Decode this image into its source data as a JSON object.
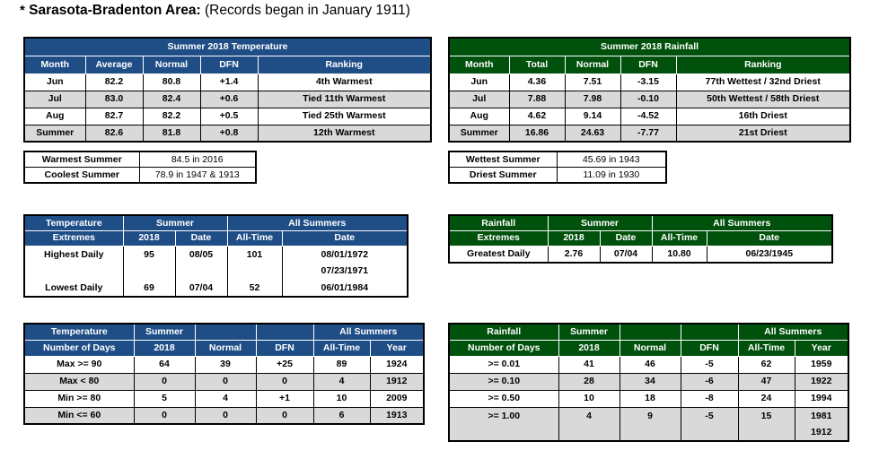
{
  "header": {
    "star": "*",
    "location": "Sarasota-Bradenton Area:",
    "records_note": "(Records began in January 1911)"
  },
  "temperature_summary": {
    "title": "Summer 2018 Temperature",
    "columns": [
      "Month",
      "Average",
      "Normal",
      "DFN",
      "Ranking"
    ],
    "rows": [
      {
        "month": "Jun",
        "average": "82.2",
        "normal": "80.8",
        "dfn": "+1.4",
        "ranking": "4th Warmest"
      },
      {
        "month": "Jul",
        "average": "83.0",
        "normal": "82.4",
        "dfn": "+0.6",
        "ranking": "Tied 11th Warmest"
      },
      {
        "month": "Aug",
        "average": "82.7",
        "normal": "82.2",
        "dfn": "+0.5",
        "ranking": "Tied 25th Warmest"
      },
      {
        "month": "Summer",
        "average": "82.6",
        "normal": "81.8",
        "dfn": "+0.8",
        "ranking": "12th Warmest"
      }
    ]
  },
  "rainfall_summary": {
    "title": "Summer 2018 Rainfall",
    "columns": [
      "Month",
      "Total",
      "Normal",
      "DFN",
      "Ranking"
    ],
    "rows": [
      {
        "month": "Jun",
        "total": "4.36",
        "normal": "7.51",
        "dfn": "-3.15",
        "ranking": "77th Wettest / 32nd Driest"
      },
      {
        "month": "Jul",
        "total": "7.88",
        "normal": "7.98",
        "dfn": "-0.10",
        "ranking": "50th Wettest / 58th Driest"
      },
      {
        "month": "Aug",
        "total": "4.62",
        "normal": "9.14",
        "dfn": "-4.52",
        "ranking": "16th Driest"
      },
      {
        "month": "Summer",
        "total": "16.86",
        "normal": "24.63",
        "dfn": "-7.77",
        "ranking": "21st Driest"
      }
    ]
  },
  "temp_records_box": {
    "rows": [
      {
        "label": "Warmest Summer",
        "value": "84.5 in 2016"
      },
      {
        "label": "Coolest Summer",
        "value": "78.9 in 1947 & 1913"
      }
    ]
  },
  "rain_records_box": {
    "rows": [
      {
        "label": "Wettest Summer",
        "value": "45.69 in 1943"
      },
      {
        "label": "Driest Summer",
        "value": "11.09 in 1930"
      }
    ]
  },
  "temperature_extremes": {
    "corner_line1": "Temperature",
    "corner_line2": "Extremes",
    "group_summer": "Summer",
    "group_all": "All Summers",
    "col_2018": "2018",
    "col_date": "Date",
    "col_alltime": "All-Time",
    "col_alldate": "Date",
    "rows": [
      {
        "label": "Highest Daily",
        "v2018": "95",
        "date": "08/05",
        "alltime": "101",
        "alldate": "08/01/1972"
      },
      {
        "label": "",
        "v2018": "",
        "date": "",
        "alltime": "",
        "alldate": "07/23/1971"
      },
      {
        "label": "Lowest Daily",
        "v2018": "69",
        "date": "07/04",
        "alltime": "52",
        "alldate": "06/01/1984"
      }
    ]
  },
  "rainfall_extremes": {
    "corner_line1": "Rainfall",
    "corner_line2": "Extremes",
    "group_summer": "Summer",
    "group_all": "All Summers",
    "col_2018": "2018",
    "col_date": "Date",
    "col_alltime": "All-Time",
    "col_alldate": "Date",
    "rows": [
      {
        "label": "Greatest Daily",
        "v2018": "2.76",
        "date": "07/04",
        "alltime": "10.80",
        "alldate": "06/23/1945"
      }
    ]
  },
  "temperature_days": {
    "corner_line1": "Temperature",
    "corner_line2": "Number of Days",
    "col_summer": "Summer",
    "col_2018": "2018",
    "col_normal": "Normal",
    "col_dfn": "DFN",
    "group_all": "All Summers",
    "col_alltime": "All-Time",
    "col_year": "Year",
    "rows": [
      {
        "label": "Max >= 90",
        "v2018": "64",
        "normal": "39",
        "dfn": "+25",
        "dfn_kind": "pos",
        "alltime": "89",
        "year": "1924"
      },
      {
        "label": "Max < 80",
        "v2018": "0",
        "normal": "0",
        "dfn": "0",
        "dfn_kind": "zero",
        "alltime": "4",
        "year": "1912"
      },
      {
        "label": "Min >= 80",
        "v2018": "5",
        "normal": "4",
        "dfn": "+1",
        "dfn_kind": "pos",
        "alltime": "10",
        "year": "2009"
      },
      {
        "label": "Min <= 60",
        "v2018": "0",
        "normal": "0",
        "dfn": "0",
        "dfn_kind": "zero",
        "alltime": "6",
        "year": "1913"
      }
    ]
  },
  "rainfall_days": {
    "corner_line1": "Rainfall",
    "corner_line2": "Number of Days",
    "col_summer": "Summer",
    "col_2018": "2018",
    "col_normal": "Normal",
    "col_dfn": "DFN",
    "group_all": "All Summers",
    "col_alltime": "All-Time",
    "col_year": "Year",
    "rows": [
      {
        "label": ">= 0.01",
        "v2018": "41",
        "normal": "46",
        "dfn": "-5",
        "alltime": "62",
        "year": "1959"
      },
      {
        "label": ">= 0.10",
        "v2018": "28",
        "normal": "34",
        "dfn": "-6",
        "alltime": "47",
        "year": "1922"
      },
      {
        "label": ">= 0.50",
        "v2018": "10",
        "normal": "18",
        "dfn": "-8",
        "alltime": "24",
        "year": "1994"
      },
      {
        "label": ">= 1.00",
        "v2018": "4",
        "normal": "9",
        "dfn": "-5",
        "alltime": "15",
        "year": "1981"
      },
      {
        "label": "",
        "v2018": "",
        "normal": "",
        "dfn": "",
        "alltime": "",
        "year": "1912"
      }
    ]
  },
  "colors": {
    "blue_header": "#1F4E87",
    "green_header": "#00510B",
    "positive_dfn": "#FF0000",
    "negative_dfn": "#7F6000",
    "shade_row": "#D9D9D9",
    "warmest": "#FF0000",
    "coolest": "#9DC3E6",
    "wettest": "#008000",
    "driest": "#BFA36A"
  }
}
